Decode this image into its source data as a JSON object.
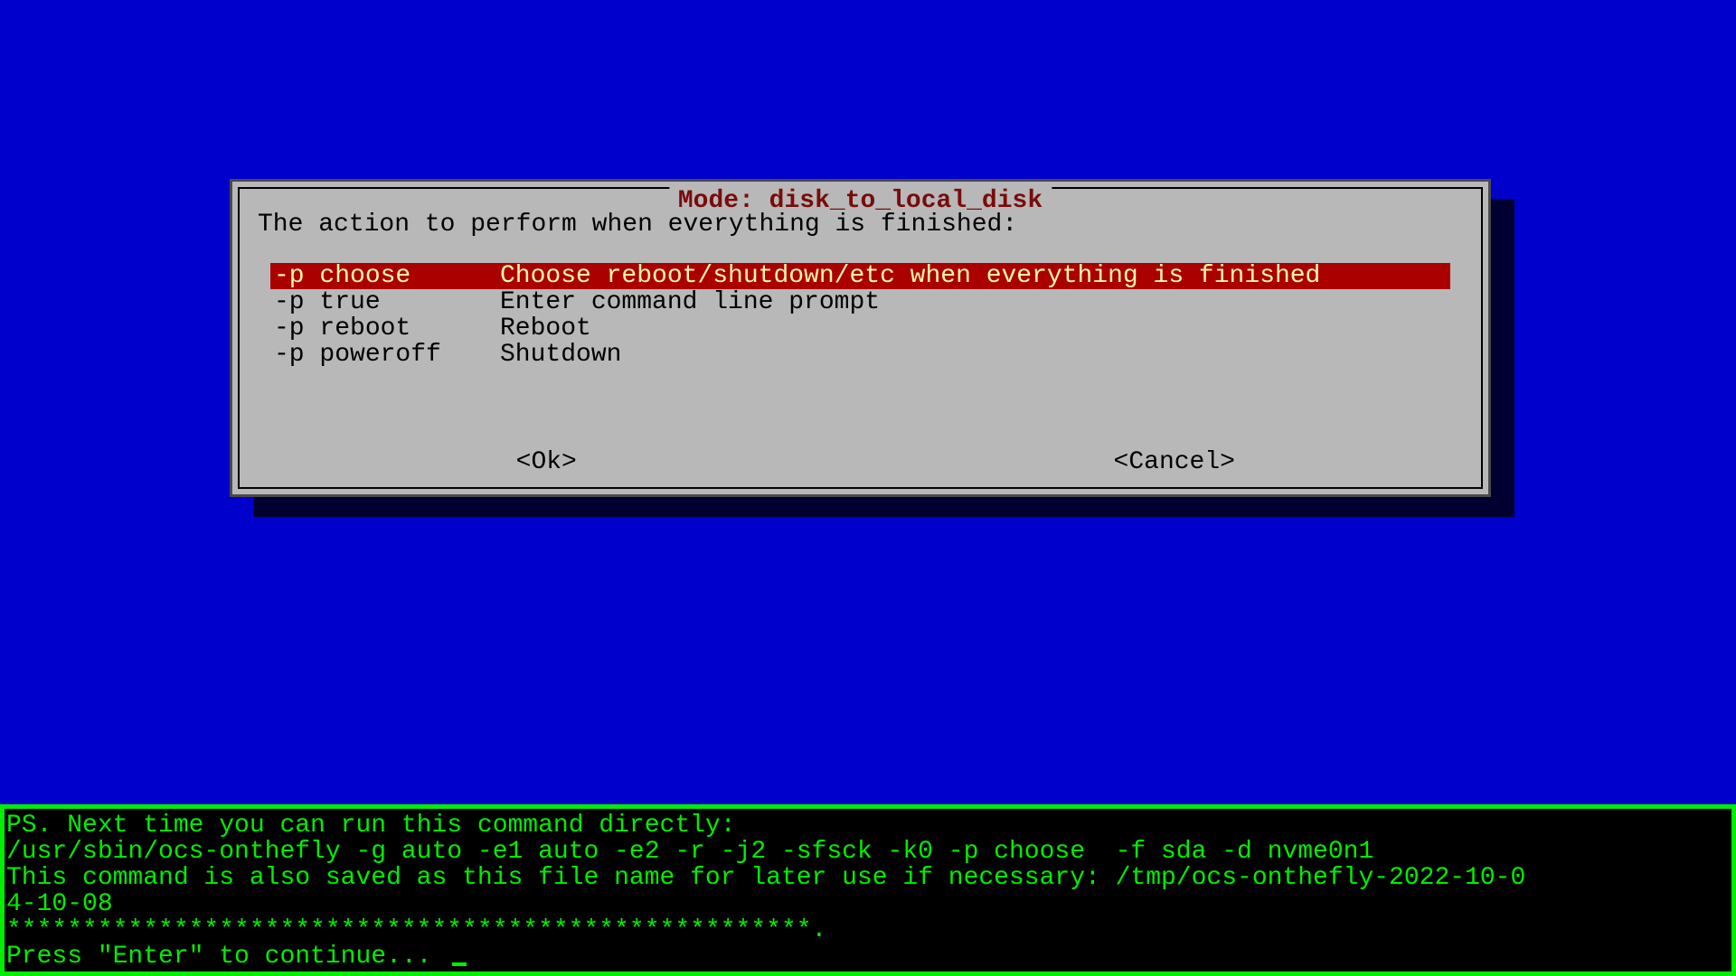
{
  "dialog": {
    "title": "Mode: disk_to_local_disk",
    "prompt": "The action to perform when everything is finished:",
    "options": [
      {
        "flag": "-p choose",
        "desc": "Choose reboot/shutdown/etc when everything is finished",
        "selected": true
      },
      {
        "flag": "-p true",
        "desc": "Enter command line prompt",
        "selected": false
      },
      {
        "flag": "-p reboot",
        "desc": "Reboot",
        "selected": false
      },
      {
        "flag": "-p poweroff",
        "desc": "Shutdown",
        "selected": false
      }
    ],
    "ok_label": "<Ok>",
    "cancel_label": "<Cancel>"
  },
  "terminal": {
    "lines": [
      "PS. Next time you can run this command directly:",
      "/usr/sbin/ocs-onthefly -g auto -e1 auto -e2 -r -j2 -sfsck -k0 -p choose  -f sda -d nvme0n1",
      "This command is also saved as this file name for later use if necessary: /tmp/ocs-onthefly-2022-10-0",
      "4-10-08",
      "*****************************************************.",
      "Press \"Enter\" to continue... "
    ]
  }
}
